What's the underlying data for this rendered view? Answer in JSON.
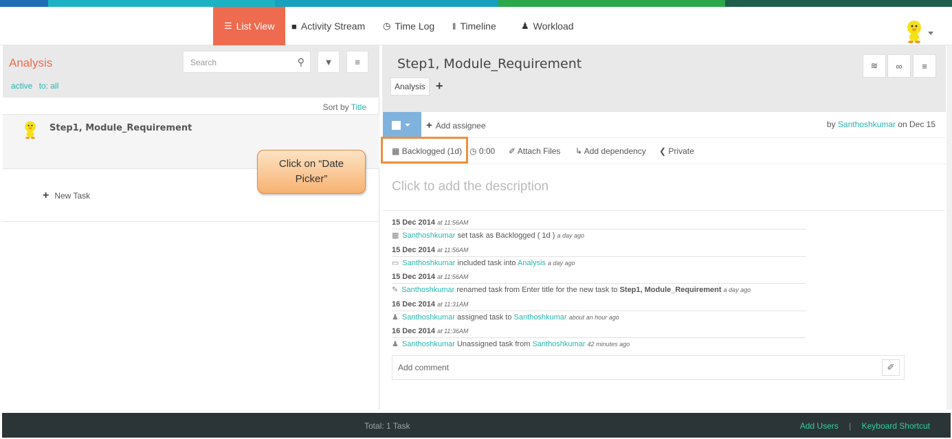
{
  "colors": {
    "accent": "#ef6b4f",
    "link": "#26b5b0",
    "footer_bg": "#2b3538",
    "footer_link": "#2fcf9f",
    "highlight": "#ef8f3c"
  },
  "stripe": [
    "#1f6db5",
    "#1bb3c4",
    "#3db84a",
    "#1e7a3a",
    "#2b3538"
  ],
  "nav": {
    "list_view": "List View",
    "activity_stream": "Activity Stream",
    "time_log": "Time Log",
    "timeline": "Timeline",
    "workload": "Workload"
  },
  "left": {
    "project_title": "Analysis",
    "filter_active": "active",
    "filter_to": "to: all",
    "search_placeholder": "Search",
    "sort_label": "Sort by",
    "sort_value": "Title",
    "task_title": "Step1, Module_Requirement",
    "new_task": "New Task"
  },
  "callout": {
    "line1": "Click on “Date",
    "line2": "Picker”"
  },
  "right": {
    "task_name": "Step1, Module_Requirement",
    "tag": "Analysis",
    "add_assignee": "Add assignee",
    "by_label": "by",
    "by_user": "Santhoshkumar",
    "by_date": "on Dec 15",
    "status": "Backlogged (1d)",
    "time": "0:00",
    "attach": "Attach Files",
    "dependency": "Add dependency",
    "privacy": "Private",
    "description_placeholder": "Click to add the description",
    "comment_placeholder": "Add comment"
  },
  "activity": [
    {
      "date": "15 Dec 2014",
      "time": "at 11:56AM",
      "user": "Santhoshkumar",
      "text": "set task as Backlogged ( 1d )",
      "ago": "a day ago"
    },
    {
      "date": "15 Dec 2014",
      "time": "at 11:56AM",
      "user": "Santhoshkumar",
      "text": "included task into",
      "target": "Analysis",
      "ago": "a day ago"
    },
    {
      "date": "15 Dec 2014",
      "time": "at 11:56AM",
      "user": "Santhoshkumar",
      "text": "renamed task from Enter title for the new task to",
      "bold": "Step1, Module_Requirement",
      "ago": "a day ago"
    },
    {
      "date": "16 Dec 2014",
      "time": "at 11:31AM",
      "user": "Santhoshkumar",
      "text": "assigned task to",
      "target": "Santhoshkumar",
      "ago": "about an hour ago"
    },
    {
      "date": "16 Dec 2014",
      "time": "at 11:36AM",
      "user": "Santhoshkumar",
      "text": "Unassigned task from",
      "target": "Santhoshkumar",
      "ago": "42 minutes ago"
    }
  ],
  "footer": {
    "total": "Total: 1 Task",
    "add_users": "Add Users",
    "sep": "|",
    "shortcut": "Keyboard Shortcut"
  }
}
